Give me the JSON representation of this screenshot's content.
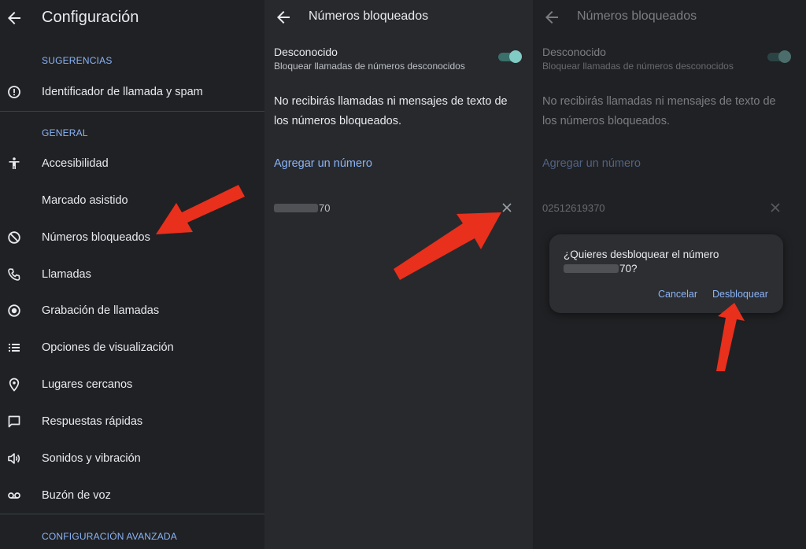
{
  "settings": {
    "title": "Configuración",
    "sections": [
      {
        "header": "SUGERENCIAS",
        "items": [
          {
            "label": "Identificador de llamada y spam",
            "icon": "info-icon"
          }
        ]
      },
      {
        "header": "GENERAL",
        "items": [
          {
            "label": "Accesibilidad",
            "icon": "accessibility-icon"
          },
          {
            "label": "Marcado asistido",
            "icon": ""
          },
          {
            "label": "Números bloqueados",
            "icon": "block-icon"
          },
          {
            "label": "Llamadas",
            "icon": "phone-icon"
          },
          {
            "label": "Grabación de llamadas",
            "icon": "record-icon"
          },
          {
            "label": "Opciones de visualización",
            "icon": "list-icon"
          },
          {
            "label": "Lugares cercanos",
            "icon": "location-icon"
          },
          {
            "label": "Respuestas rápidas",
            "icon": "message-icon"
          },
          {
            "label": "Sonidos y vibración",
            "icon": "volume-icon"
          },
          {
            "label": "Buzón de voz",
            "icon": "voicemail-icon"
          }
        ]
      },
      {
        "header": "CONFIGURACIÓN AVANZADA",
        "items": []
      }
    ]
  },
  "blocked": {
    "title": "Números bloqueados",
    "unknown_title": "Desconocido",
    "unknown_subtitle": "Bloquear llamadas de números desconocidos",
    "unknown_enabled": true,
    "info_text": "No recibirás llamadas ni mensajes de texto de los números bloqueados.",
    "add_number": "Agregar un número",
    "number_visible_suffix": "70",
    "number_full": "02512619370"
  },
  "dialog": {
    "question_prefix": "¿Quieres desbloquear el número",
    "question_suffix": "70?",
    "cancel_label": "Cancelar",
    "unblock_label": "Desbloquear"
  },
  "colors": {
    "background": "#202124",
    "panel_background": "#28292c",
    "accent": "#8ab4f8",
    "toggle_on": "#80cbc4",
    "annotation_arrow": "#e8301c"
  }
}
